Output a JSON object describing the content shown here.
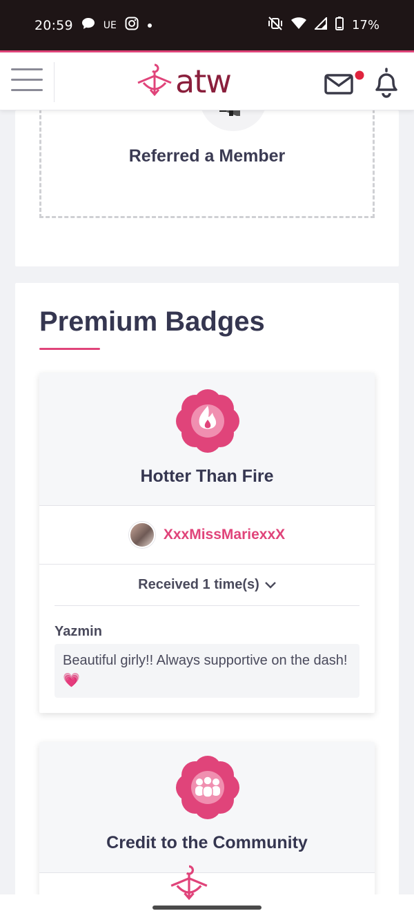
{
  "status_bar": {
    "time": "20:59",
    "carrier": "UE",
    "battery": "17%"
  },
  "header": {
    "logo_text": "atw",
    "has_unread_mail": true
  },
  "top_card": {
    "title": "Referred a Member"
  },
  "premium_badges": {
    "title": "Premium Badges",
    "badges": [
      {
        "name": "Hotter Than Fire",
        "icon": "flame-icon",
        "giver": "XxxMissMariexxX",
        "received": "Received 1 time(s)",
        "comment_author": "Yazmin",
        "comment_text": "Beautiful girly!! Always supportive on the dash!💗"
      },
      {
        "name": "Credit to the Community",
        "icon": "community-icon"
      }
    ]
  },
  "colors": {
    "accent": "#e0447a",
    "brand": "#8a1f3c",
    "status_bar_bg": "#1e1516"
  }
}
